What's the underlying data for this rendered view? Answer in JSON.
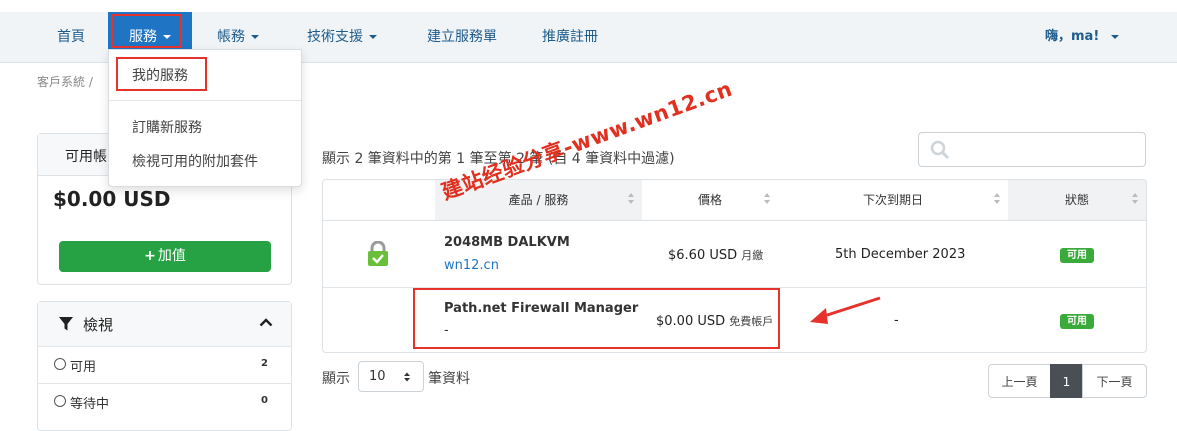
{
  "nav": {
    "items": [
      {
        "label": "首頁"
      },
      {
        "label": "服務",
        "active": true
      },
      {
        "label": "帳務"
      },
      {
        "label": "技術支援"
      },
      {
        "label": "建立服務單"
      },
      {
        "label": "推廣註冊"
      }
    ],
    "user_greeting": "嗨，ma!"
  },
  "breadcrumb": "客戶系統 /",
  "dropdown": {
    "items": [
      {
        "label": "我的服務"
      },
      {
        "label": "訂購新服務"
      },
      {
        "label": "檢視可用的附加套件"
      }
    ]
  },
  "credit_panel": {
    "label": "可用帳",
    "amount": "$0.00 USD",
    "add_button_icon": "plus-icon",
    "add_button_label": "加值"
  },
  "filter_panel": {
    "title": "檢視",
    "options": [
      {
        "label": "可用",
        "count": "2"
      },
      {
        "label": "等待中",
        "count": "0"
      }
    ]
  },
  "table": {
    "info": "顯示 2 筆資料中的第 1 筆至第 2 筆 (自 4 筆資料中過濾)",
    "columns": [
      "",
      "產品 / 服務",
      "價格",
      "下次到期日",
      "狀態"
    ],
    "rows": [
      {
        "icon": "lock-check-icon",
        "product": "2048MB DALKVM",
        "domain": "wn12.cn",
        "price": "$6.60 USD",
        "cycle": "月繳",
        "next_due": "5th December 2023",
        "status": "可用"
      },
      {
        "icon": "",
        "product": "Path.net Firewall Manager",
        "domain": "-",
        "price": "$0.00 USD",
        "cycle": "免費帳戶",
        "next_due": "-",
        "status": "可用"
      }
    ]
  },
  "page_size": {
    "prefix": "顯示",
    "value": "10",
    "suffix": "筆資料"
  },
  "pagination": {
    "prev": "上一頁",
    "current": "1",
    "next": "下一頁"
  },
  "watermark": "建站经验分享-www.wn12.cn",
  "colors": {
    "accent": "#1f75c4",
    "highlight_red": "#e5322d",
    "success": "#26a244",
    "status_badge": "#3aaa3a"
  }
}
